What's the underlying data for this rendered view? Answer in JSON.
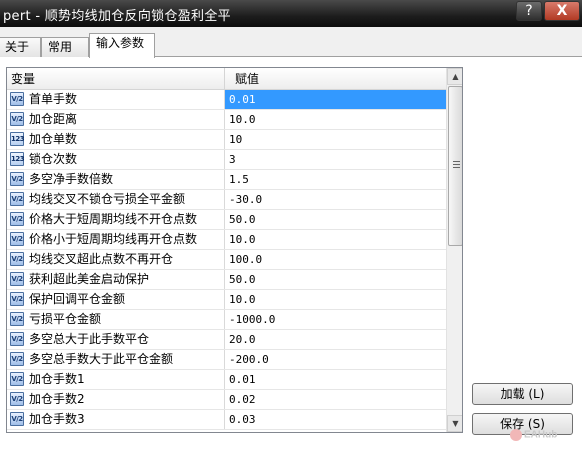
{
  "window": {
    "title": "pert - 顺势均线加仓反向锁仓盈利全平",
    "help_label": "?",
    "close_label": "X"
  },
  "tabs": [
    {
      "label": "关于"
    },
    {
      "label": "常用"
    },
    {
      "label": "输入参数"
    }
  ],
  "grid": {
    "col_variable": "变量",
    "col_value": "赋值",
    "rows": [
      {
        "icon": "double-value-icon",
        "icon_text": "V/2",
        "name": "首单手数",
        "value": "0.01"
      },
      {
        "icon": "double-value-icon",
        "icon_text": "V/2",
        "name": "加仓距离",
        "value": "10.0"
      },
      {
        "icon": "integer-value-icon",
        "icon_text": "123",
        "name": "加仓单数",
        "value": "10"
      },
      {
        "icon": "integer-value-icon",
        "icon_text": "123",
        "name": "锁仓次数",
        "value": "3"
      },
      {
        "icon": "double-value-icon",
        "icon_text": "V/2",
        "name": "多空净手数倍数",
        "value": "1.5"
      },
      {
        "icon": "double-value-icon",
        "icon_text": "V/2",
        "name": "均线交叉不锁仓亏损全平金额",
        "value": "-30.0"
      },
      {
        "icon": "double-value-icon",
        "icon_text": "V/2",
        "name": "价格大于短周期均线不开仓点数",
        "value": "50.0"
      },
      {
        "icon": "double-value-icon",
        "icon_text": "V/2",
        "name": "价格小于短周期均线再开仓点数",
        "value": "10.0"
      },
      {
        "icon": "double-value-icon",
        "icon_text": "V/2",
        "name": "均线交叉超此点数不再开仓",
        "value": "100.0"
      },
      {
        "icon": "double-value-icon",
        "icon_text": "V/2",
        "name": "获利超此美金启动保护",
        "value": "50.0"
      },
      {
        "icon": "double-value-icon",
        "icon_text": "V/2",
        "name": "保护回调平仓金额",
        "value": "10.0"
      },
      {
        "icon": "double-value-icon",
        "icon_text": "V/2",
        "name": "亏损平仓金额",
        "value": "-1000.0"
      },
      {
        "icon": "double-value-icon",
        "icon_text": "V/2",
        "name": "多空总大于此手数平仓",
        "value": "20.0"
      },
      {
        "icon": "double-value-icon",
        "icon_text": "V/2",
        "name": "多空总手数大于此平仓金额",
        "value": "-200.0"
      },
      {
        "icon": "double-value-icon",
        "icon_text": "V/2",
        "name": "加仓手数1",
        "value": "0.01"
      },
      {
        "icon": "double-value-icon",
        "icon_text": "V/2",
        "name": "加仓手数2",
        "value": "0.02"
      },
      {
        "icon": "double-value-icon",
        "icon_text": "V/2",
        "name": "加仓手数3",
        "value": "0.03"
      }
    ]
  },
  "buttons": {
    "load_label": "加载 (L)",
    "save_label": "保存 (S)"
  },
  "watermark": "EAHub",
  "colors": {
    "selection": "#3399ff",
    "titlebar": "#1d1d1d"
  }
}
